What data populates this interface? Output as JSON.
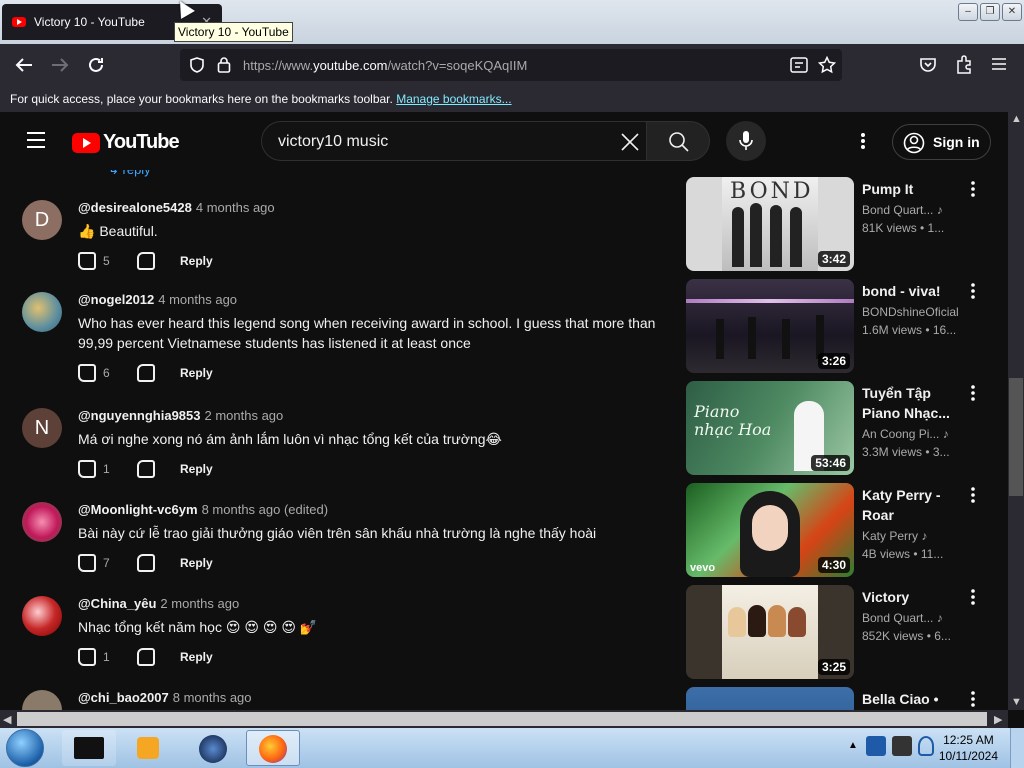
{
  "browser": {
    "tab_title": "Victory 10 - YouTube",
    "tooltip": "Victory 10 - YouTube",
    "tab_close": "✕",
    "url_prefix": "https://www.",
    "url_host": "youtube.com",
    "url_path": "/watch?v=soqeKQAqIIM",
    "bookmarks_hint": "For quick access, place your bookmarks here on the bookmarks toolbar.",
    "bookmarks_link": "Manage bookmarks...",
    "win_minimize": "–",
    "win_restore": "❐",
    "win_close": "✕",
    "icons": [
      "back-icon",
      "forward-icon",
      "reload-icon",
      "shield-icon",
      "lock-icon",
      "reader-icon",
      "star-icon",
      "pocket-icon",
      "extensions-icon",
      "menu-icon"
    ]
  },
  "youtube": {
    "logo_text": "YouTube",
    "search_query": "victory10 music",
    "sign_in": "Sign in"
  },
  "comments": [
    {
      "author": "@desirealone5428",
      "time": "4 months ago",
      "text": "👍 Beautiful.",
      "likes": "5",
      "avatar_letter": "D",
      "avatar_color": "#8d6e63"
    },
    {
      "author": "@nogel2012",
      "time": "4 months ago",
      "text": "Who has ever heard this legend song when receiving award in school. I guess that more than 99,99 percent Vietnamese students has listened it at least once",
      "likes": "6",
      "avatar_letter": "",
      "avatar_color": "#6a8fa0"
    },
    {
      "author": "@nguyennghia9853",
      "time": "2 months ago",
      "text": "Má ơi nghe xong nó ám ảnh lắm luôn vì nhạc tổng kết của trường😂",
      "likes": "1",
      "avatar_letter": "N",
      "avatar_color": "#5d4037"
    },
    {
      "author": "@Moonlight-vc6ym",
      "time": "8 months ago (edited)",
      "text": "Bài này cứ lễ trao giải thưởng giáo viên trên sân khấu nhà trường là nghe thấy hoài",
      "likes": "7",
      "avatar_letter": "",
      "avatar_color": "#c2185b"
    },
    {
      "author": "@China_yêu",
      "time": "2 months ago",
      "text": "Nhạc tổng kết năm học 😍 😍 😍 😍 💅",
      "likes": "1",
      "avatar_letter": "",
      "avatar_color": "#c62828"
    },
    {
      "author": "@chi_bao2007",
      "time": "8 months ago",
      "text": "",
      "likes": "",
      "avatar_letter": "",
      "avatar_color": "#8a7a6a"
    }
  ],
  "reply_label": "Reply",
  "recommendations": [
    {
      "title": "Pump It",
      "channel": "Bond Quart...",
      "meta": "81K views  • 1...",
      "duration": "3:42",
      "music_note": true
    },
    {
      "title": "bond - viva!",
      "channel": "BONDshineOficial",
      "meta": "1.6M views  • 16...",
      "duration": "3:26",
      "music_note": false
    },
    {
      "title": "Tuyển Tập Piano Nhạc...",
      "channel": "An Coong Pi...",
      "meta": "3.3M views  • 3...",
      "duration": "53:46",
      "music_note": true
    },
    {
      "title": "Katy Perry - Roar",
      "channel": "Katy Perry",
      "meta": "4B views  • 11...",
      "duration": "4:30",
      "music_note": true
    },
    {
      "title": "Victory",
      "channel": "Bond Quart...",
      "meta": "852K views  • 6...",
      "duration": "3:25",
      "music_note": true
    },
    {
      "title": "Bella Ciao •",
      "channel": "",
      "meta": "",
      "duration": "",
      "music_note": false
    }
  ],
  "thumbnail_texts": {
    "bond_logo": "BOND",
    "piano_script": "Piano nhạc Hoa",
    "vevo": "vevo"
  },
  "taskbar": {
    "time": "12:25 AM",
    "date": "10/11/2024"
  }
}
